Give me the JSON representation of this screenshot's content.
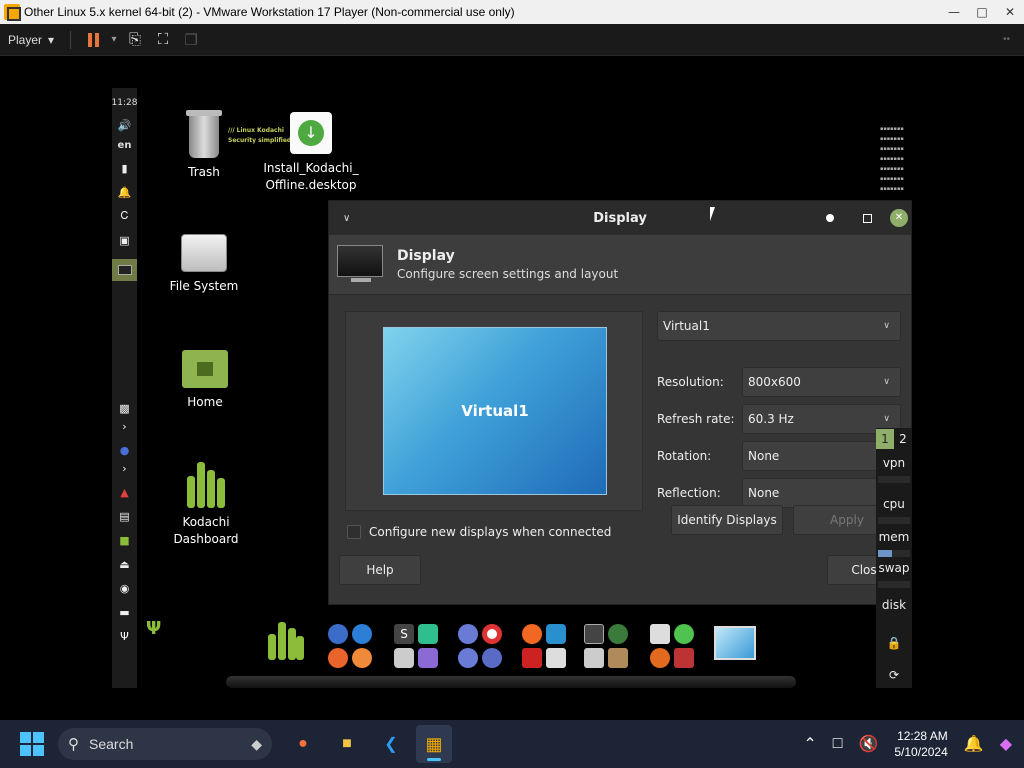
{
  "vmware": {
    "title": "Other Linux 5.x kernel 64-bit (2) - VMware Workstation 17 Player (Non-commercial use only)",
    "player_menu": "Player"
  },
  "guest": {
    "panel": {
      "clock": "11:28",
      "lang": "en"
    },
    "desktop_icons": [
      {
        "label": "Trash"
      },
      {
        "label": "Install_Kodachi_\nOffline.desktop"
      },
      {
        "label": "File System"
      },
      {
        "label": "Home"
      },
      {
        "label": "Kodachi\nDashboard"
      }
    ],
    "kodachi_tagline_1": "/// Linux Kodachi",
    "kodachi_tagline_2": "Security simplified",
    "display_dialog": {
      "title": "Display",
      "header_title": "Display",
      "header_subtitle": "Configure screen settings and layout",
      "monitor_name": "Virtual1",
      "output_select": "Virtual1",
      "resolution_label": "Resolution:",
      "resolution_value": "800x600",
      "refresh_label": "Refresh rate:",
      "refresh_value": "60.3 Hz",
      "rotation_label": "Rotation:",
      "rotation_value": "None",
      "reflection_label": "Reflection:",
      "reflection_value": "None",
      "configure_new_label": "Configure new displays when connected",
      "identify_button": "Identify Displays",
      "apply_button": "Apply",
      "help_button": "Help",
      "close_button": "Clos"
    },
    "right_panel": {
      "workspaces": [
        "1",
        "2"
      ],
      "items": [
        "vpn",
        "cpu",
        "mem",
        "swap",
        "disk"
      ],
      "mem_fraction": 0.45
    }
  },
  "taskbar": {
    "search_placeholder": "Search",
    "time": "12:28 AM",
    "date": "5/10/2024"
  }
}
